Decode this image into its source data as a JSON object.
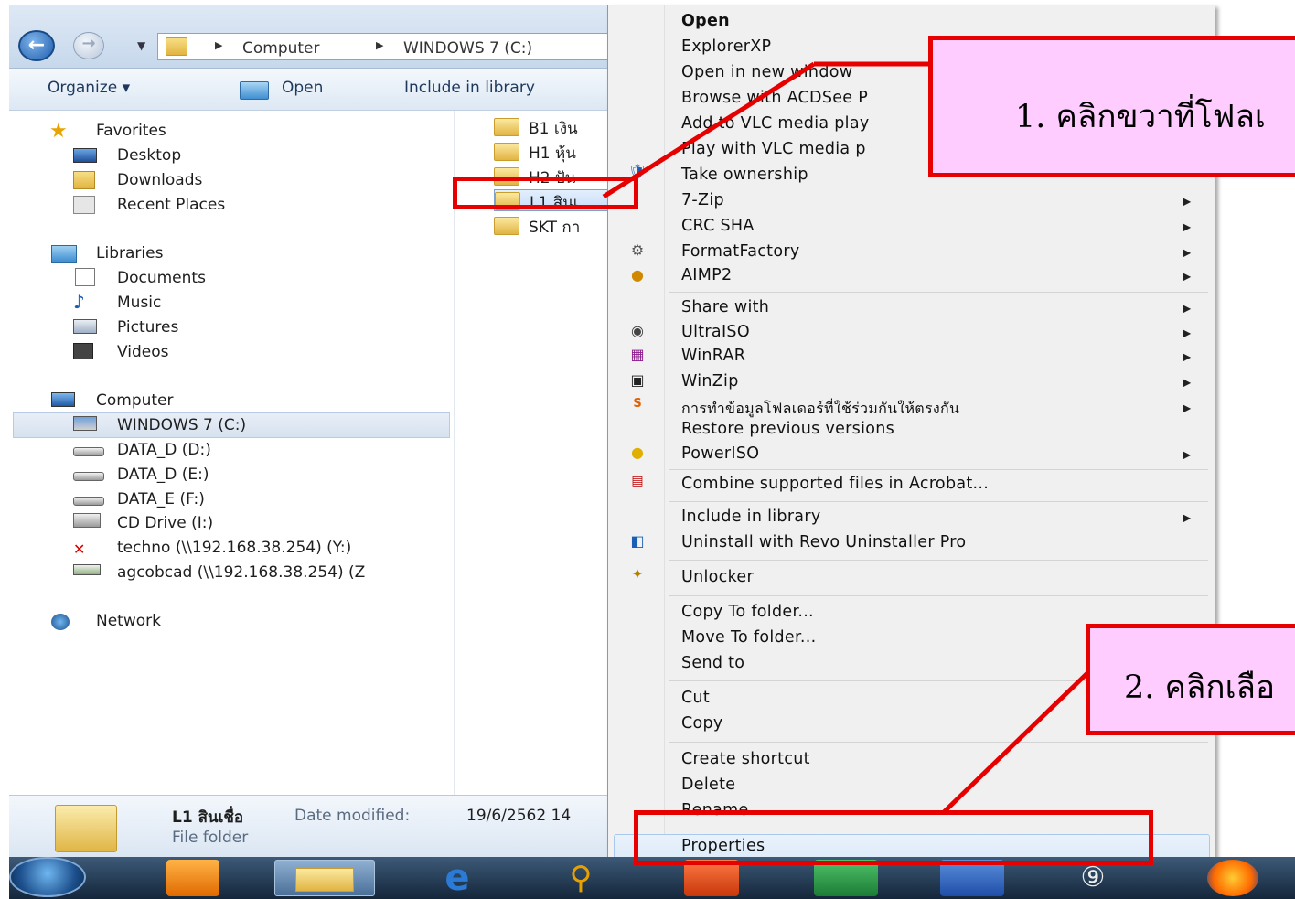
{
  "address": {
    "crumbs": [
      "Computer",
      "WINDOWS 7 (C:)"
    ]
  },
  "toolbar": {
    "organize": "Organize",
    "open": "Open",
    "include_in_library": "Include in library"
  },
  "navpane": {
    "favorites": {
      "label": "Favorites",
      "items": [
        "Desktop",
        "Downloads",
        "Recent Places"
      ]
    },
    "libraries": {
      "label": "Libraries",
      "items": [
        "Documents",
        "Music",
        "Pictures",
        "Videos"
      ]
    },
    "computer": {
      "label": "Computer",
      "items": [
        "WINDOWS 7 (C:)",
        "DATA_D (D:)",
        "DATA_D (E:)",
        "DATA_E (F:)",
        "CD Drive (I:)",
        "techno (\\\\192.168.38.254) (Y:)",
        "agcobcad (\\\\192.168.38.254) (Z"
      ]
    },
    "network": {
      "label": "Network"
    }
  },
  "files": [
    "B1 เงิน",
    "H1 หุ้น",
    "H2 ปัน",
    "L1 สินเ",
    "SKT กา"
  ],
  "details": {
    "name": "L1 สินเชื่อ",
    "date_label": "Date modified:",
    "date_value": "19/6/2562 14",
    "type": "File folder"
  },
  "menu": {
    "items": [
      "Open",
      "ExplorerXP",
      "Open in new window",
      "Browse with ACDSee P",
      "Add to VLC media play",
      "Play with VLC media p",
      "Take ownership",
      "7-Zip",
      "CRC SHA",
      "FormatFactory",
      "AIMP2",
      "Share with",
      "UltraISO",
      "WinRAR",
      "WinZip",
      "การทำข้อมูลโฟลเดอร์ที่ใช้ร่วมกันให้ตรงกัน",
      "Restore previous versions",
      "PowerISO",
      "Combine supported files in Acrobat...",
      "Include in library",
      "Uninstall with Revo Uninstaller Pro",
      "Unlocker",
      "Copy To folder...",
      "Move To folder...",
      "Send to",
      "Cut",
      "Copy",
      "Create shortcut",
      "Delete",
      "Rename",
      "Properties"
    ]
  },
  "callouts": {
    "step1": "1. คลิกขวาที่โฟลเ",
    "step2": "2. คลิกเลือ"
  },
  "colors": {
    "annotation_red": "#e60000",
    "callout_fill": "#ffccff",
    "menu_bg": "#f0f0f0"
  }
}
